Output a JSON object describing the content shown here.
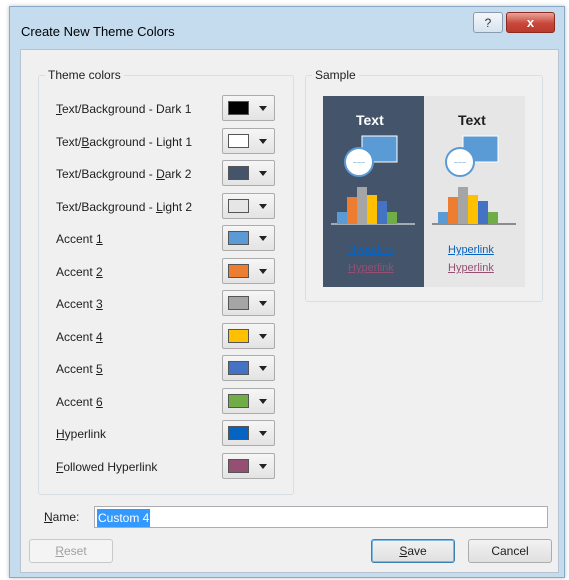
{
  "window": {
    "title": "Create New Theme Colors",
    "help_label": "?",
    "close_label": "x"
  },
  "theme_colors": {
    "legend": "Theme colors",
    "rows": [
      {
        "pre": "",
        "key": "T",
        "post": "ext/Background - Dark 1",
        "color": "#000000"
      },
      {
        "pre": "Text/",
        "key": "B",
        "post": "ackground - Light 1",
        "color": "#ffffff"
      },
      {
        "pre": "Text/Background - ",
        "key": "D",
        "post": "ark 2",
        "color": "#44546a"
      },
      {
        "pre": "Text/Background - ",
        "key": "L",
        "post": "ight 2",
        "color": "#e7e6e6"
      },
      {
        "pre": "Accent ",
        "key": "1",
        "post": "",
        "color": "#5b9bd5"
      },
      {
        "pre": "Accent ",
        "key": "2",
        "post": "",
        "color": "#ed7d31"
      },
      {
        "pre": "Accent ",
        "key": "3",
        "post": "",
        "color": "#a5a5a5"
      },
      {
        "pre": "Accent ",
        "key": "4",
        "post": "",
        "color": "#ffc000"
      },
      {
        "pre": "Accent ",
        "key": "5",
        "post": "",
        "color": "#4472c4"
      },
      {
        "pre": "Accent ",
        "key": "6",
        "post": "",
        "color": "#70ad47"
      },
      {
        "pre": "",
        "key": "H",
        "post": "yperlink",
        "color": "#0563c1"
      },
      {
        "pre": "",
        "key": "F",
        "post": "ollowed Hyperlink",
        "color": "#954f72"
      }
    ]
  },
  "sample": {
    "legend": "Sample",
    "dark": {
      "text": "Text",
      "hyperlink": "Hyperlink",
      "followed": "Hyperlink"
    },
    "light": {
      "text": "Text",
      "hyperlink": "Hyperlink",
      "followed": "Hyperlink"
    }
  },
  "name_field": {
    "label_key": "N",
    "label_rest": "ame:",
    "value": "Custom 4"
  },
  "buttons": {
    "reset_key": "R",
    "reset_rest": "eset",
    "save_key": "S",
    "save_rest": "ave",
    "cancel": "Cancel"
  },
  "colors": {
    "accent1": "#5b9bd5",
    "accent2": "#ed7d31",
    "accent3": "#a5a5a5",
    "accent4": "#ffc000",
    "accent5": "#4472c4",
    "accent6": "#70ad47",
    "hyperlink": "#0563c1",
    "followed": "#954f72",
    "dark2": "#44546a",
    "light2": "#e7e6e6"
  }
}
